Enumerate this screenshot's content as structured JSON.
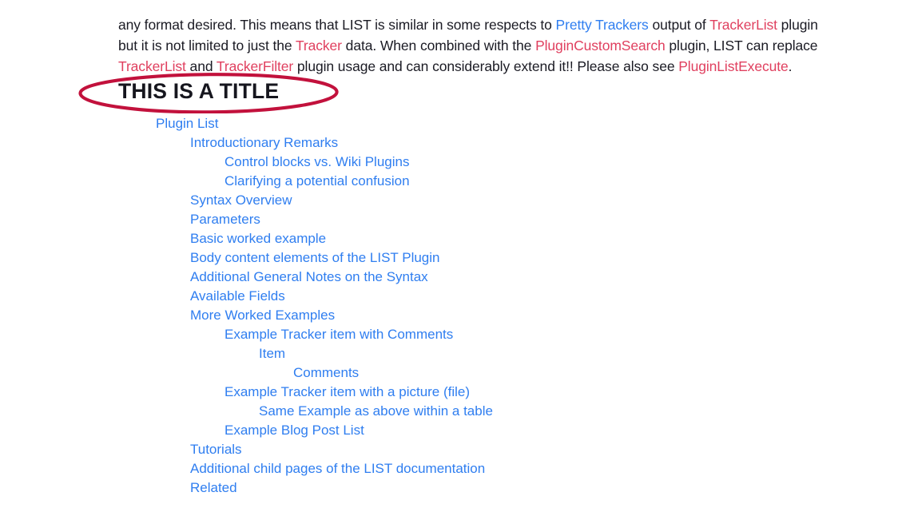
{
  "paragraph": {
    "seg1": "any format desired. This means that LIST is similar in some respects to ",
    "link_pretty_trackers": "Pretty Trackers",
    "seg2": " output of ",
    "link_trackerlist_1": "TrackerList",
    "seg3": " plugin but it is not limited to just the ",
    "link_tracker": "Tracker",
    "seg4": " data. When combined with the ",
    "link_plugincustomsearch": "PluginCustomSearch",
    "seg5": " plugin, LIST can replace ",
    "link_trackerlist_2": "TrackerList",
    "seg6": " and ",
    "link_trackerfilter": "TrackerFilter",
    "seg7": " plugin usage and can considerably extend it!! Please also see ",
    "link_pluginlistexecute": "PluginListExecute",
    "seg8": "."
  },
  "title": {
    "text": "THIS IS A TITLE",
    "annotation_shape": "ellipse",
    "annotation_color": "#c2113c"
  },
  "colors": {
    "link_blue": "#2f7ef0",
    "link_red": "#e0405f",
    "body_text": "#1b1b24",
    "annotation": "#c2113c"
  },
  "toc": {
    "items": [
      {
        "label": "Plugin List",
        "level": 0
      },
      {
        "label": "Introductionary Remarks",
        "level": 1
      },
      {
        "label": "Control blocks vs. Wiki Plugins",
        "level": 2
      },
      {
        "label": "Clarifying a potential confusion",
        "level": 2
      },
      {
        "label": "Syntax Overview",
        "level": 1
      },
      {
        "label": "Parameters",
        "level": 1
      },
      {
        "label": "Basic worked example",
        "level": 1
      },
      {
        "label": "Body content elements of the LIST Plugin",
        "level": 1
      },
      {
        "label": "Additional General Notes on the Syntax",
        "level": 1
      },
      {
        "label": "Available Fields",
        "level": 1
      },
      {
        "label": "More Worked Examples",
        "level": 1
      },
      {
        "label": "Example Tracker item with Comments",
        "level": 2
      },
      {
        "label": "Item",
        "level": 3
      },
      {
        "label": "Comments",
        "level": 4
      },
      {
        "label": "Example Tracker item with a picture (file)",
        "level": 2
      },
      {
        "label": "Same Example as above within a table",
        "level": 3
      },
      {
        "label": "Example Blog Post List",
        "level": 2
      },
      {
        "label": "Tutorials",
        "level": 1
      },
      {
        "label": "Additional child pages of the LIST documentation",
        "level": 1
      },
      {
        "label": "Related",
        "level": 1
      }
    ]
  }
}
